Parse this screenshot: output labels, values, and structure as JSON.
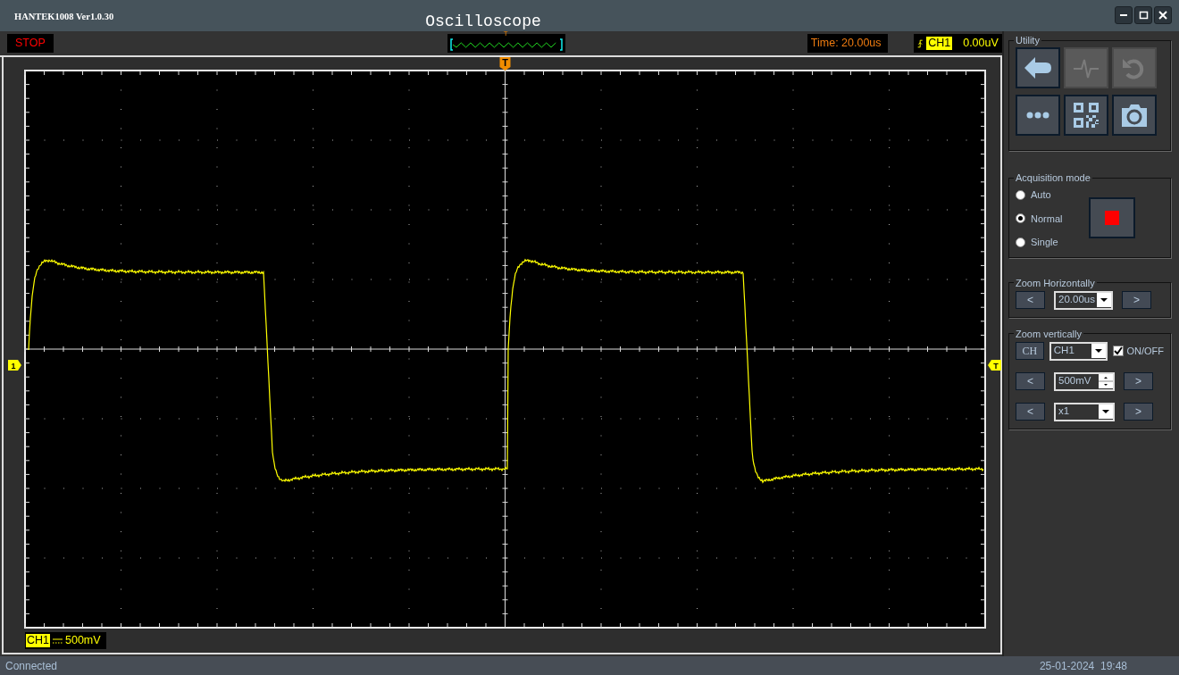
{
  "window": {
    "title": "HANTEK1008 Ver1.0.30",
    "heading": "Oscilloscope"
  },
  "status_strip": {
    "run_state": "STOP",
    "overview_marker": "T",
    "time": "Time: 20.00us",
    "trigger_channel": "CH1",
    "trigger_level": "0.00uV"
  },
  "scope": {
    "trigger_position_marker": "T",
    "channel_marker": "1",
    "trigger_level_marker": "T",
    "channel_label": "CH1",
    "scale": "500mV"
  },
  "utility": {
    "title": "Utility",
    "buttons": [
      {
        "kind": "back",
        "disabled": false
      },
      {
        "kind": "pulse",
        "disabled": true
      },
      {
        "kind": "undo",
        "disabled": true
      },
      {
        "kind": "more",
        "disabled": false
      },
      {
        "kind": "qr",
        "disabled": false
      },
      {
        "kind": "camera",
        "disabled": false
      }
    ]
  },
  "acquisition": {
    "title": "Acquisition mode",
    "options": [
      {
        "label": "Auto",
        "selected": false
      },
      {
        "label": "Normal",
        "selected": true
      },
      {
        "label": "Single",
        "selected": false
      }
    ]
  },
  "zoom_horizontal": {
    "title": "Zoom Horizontally",
    "prev": "<",
    "value": "20.00us",
    "next": ">"
  },
  "zoom_vertical": {
    "title": "Zoom vertically",
    "channel_button": "CH",
    "channel": "CH1",
    "toggle": {
      "label": "ON/OFF",
      "checked": true
    },
    "rows": [
      {
        "kind": "spinner",
        "prev": "<",
        "value": "500mV",
        "next": ">"
      },
      {
        "kind": "dropdown",
        "prev": "<",
        "value": "x1",
        "next": ">"
      }
    ]
  },
  "status_bar": {
    "connection": "Connected",
    "datetime": "25-01-2024  19:48"
  }
}
